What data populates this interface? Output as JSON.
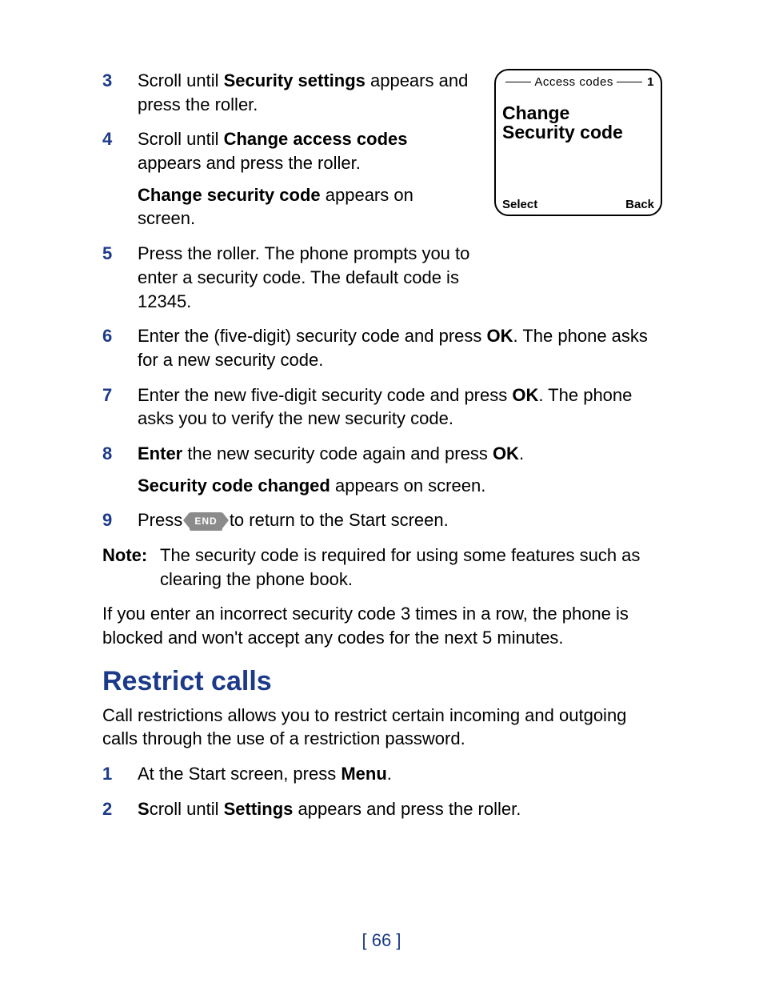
{
  "screen": {
    "header": "Access codes",
    "index": "1",
    "line1": "Change",
    "line2": "Security code",
    "soft_left": "Select",
    "soft_right": "Back"
  },
  "steps_a": {
    "s3": {
      "n": "3",
      "t1": "Scroll until ",
      "b1": "Security settings",
      "t2": " appears and press the roller."
    },
    "s4": {
      "n": "4",
      "t1": "Scroll until ",
      "b1": "Change access codes",
      "t2": " appears and press the roller.",
      "sub_b": "Change security code",
      "sub_t": " appears on screen."
    },
    "s5": {
      "n": "5",
      "t": "Press the roller. The phone prompts you to enter a security code. The default code is 12345."
    }
  },
  "steps_b": {
    "s6": {
      "n": "6",
      "t1": "Enter the (five-digit) security code and press ",
      "b1": "OK",
      "t2": ". The phone asks for a new security code."
    },
    "s7": {
      "n": "7",
      "t1": "Enter the new five-digit security code and press ",
      "b1": "OK",
      "t2": ". The phone asks you to verify the new security code."
    },
    "s8": {
      "n": "8",
      "b1": "Enter",
      "t1": " the new security code again and press ",
      "b2": "OK",
      "t2": ".",
      "sub_b": "Security code changed",
      "sub_t": " appears on screen."
    },
    "s9": {
      "n": "9",
      "t1": "Press ",
      "key": "END",
      "t2": " to return to the Start screen."
    }
  },
  "note": {
    "label": "Note:",
    "text": "The security code is required for using some features such as clearing the phone book."
  },
  "para_block": "If you enter an incorrect security code 3 times in a row, the phone is blocked and won't accept any codes for the next 5 minutes.",
  "section": "Restrict calls",
  "section_intro": "Call restrictions allows you to restrict certain incoming and outgoing calls through the use of a restriction password.",
  "steps_c": {
    "s1": {
      "n": "1",
      "t1": "At the Start screen, press ",
      "b1": "Menu",
      "t2": "."
    },
    "s2": {
      "n": "2",
      "b1": "S",
      "t1": "croll until ",
      "b2": "Settings",
      "t2": " appears and press the roller."
    }
  },
  "pagenum": "[ 66 ]"
}
